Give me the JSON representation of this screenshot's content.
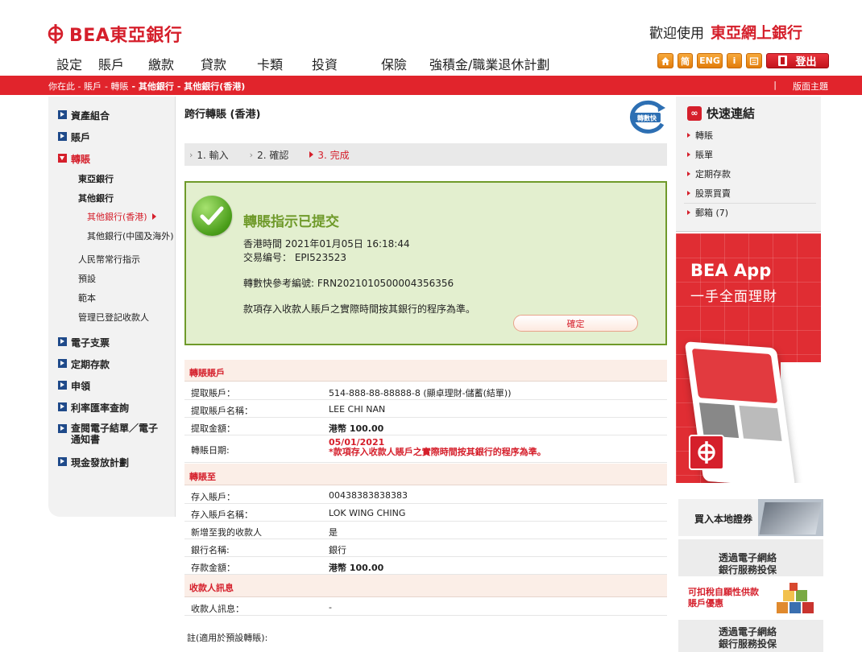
{
  "header": {
    "brand": "BEA東亞銀行",
    "welcome": "歡迎使用",
    "service": "東亞網上銀行"
  },
  "main_nav": [
    "設定",
    "賬戶",
    "繳款",
    "貸款",
    "卡類",
    "投資",
    "保險",
    "強積金/職業退休計劃"
  ],
  "utility": {
    "home_icon": "home-icon",
    "simplified": "简",
    "english": "ENG",
    "info": "i",
    "mail_icon": "inbox-icon",
    "logout": "登出"
  },
  "breadcrumb": {
    "prefix": "你在此 - 賬戶",
    "transfer": "- 轉賬",
    "other_bank": "- 其他銀行",
    "other_bank_hk": "- 其他銀行(香港)"
  },
  "theme": {
    "separator": "|",
    "label": "版面主題"
  },
  "sidebar": {
    "portfolio": "資產組合",
    "accounts": "賬戶",
    "transfer": "轉賬",
    "sub": {
      "bea": "東亞銀行",
      "other": "其他銀行",
      "other_hk": "其他銀行(香港)",
      "other_cn": "其他銀行(中國及海外)",
      "rmb": "人民幣常行指示",
      "preset": "預設",
      "template": "範本",
      "payees": "管理已登記收款人"
    },
    "echeque": "電子支票",
    "fixed_deposit": "定期存款",
    "apply": "申領",
    "rates": "利率匯率查詢",
    "estatement": "查閱電子結單／電子通知書",
    "cash_plan": "現金發放計劃"
  },
  "page": {
    "title": "跨行轉賬 (香港)",
    "fps_logo": "轉數快"
  },
  "steps": {
    "s1": "1. 輸入",
    "s2": "2. 確認",
    "s3": "3. 完成"
  },
  "success": {
    "title": "轉賬指示已提交",
    "time": "香港時間 2021年01月05日 16:18:44",
    "txn": "交易编号： EPI523523",
    "fps_ref": "轉數快參考編號: FRN2021010500004356356",
    "note": "款項存入收款人賬戶之實際時間按其銀行的程序為準。",
    "confirm": "確定"
  },
  "from_section": {
    "header": "轉賬賬戶",
    "rows": [
      {
        "label": "提取賬戶：",
        "value": "514-888-88-88888-8 (顯卓理財-儲蓄(結單))"
      },
      {
        "label": "提取賬戶名稱：",
        "value": "LEE CHI NAN"
      },
      {
        "label": "提取金額：",
        "value": "港幣 100.00"
      },
      {
        "label": "轉賬日期:",
        "value": "05/01/2021",
        "value2": "*款項存入收款人賬戶之實際時間按其銀行的程序為準。"
      }
    ]
  },
  "to_section": {
    "header": "轉賬至",
    "rows": [
      {
        "label": "存入賬戶：",
        "value": "00438383838383"
      },
      {
        "label": "存入賬戶名稱：",
        "value": "LOK WING CHING"
      },
      {
        "label": "新增至我的收款人",
        "value": "是"
      },
      {
        "label": "銀行名稱:",
        "value": "銀行"
      },
      {
        "label": "存款金額：",
        "value": "港幣 100.00"
      }
    ]
  },
  "payee_section": {
    "header": "收款人訊息",
    "rows": [
      {
        "label": "收款人訊息：",
        "value": "-"
      }
    ]
  },
  "footnote": "註(適用於預設轉賬):",
  "quick_links": {
    "title": "快速連結",
    "items": [
      "轉賬",
      "賬單",
      "定期存款",
      "股票買賣",
      "郵箱 (7)"
    ]
  },
  "app_banner": {
    "line1": "BEA App",
    "line2": "一手全面理財"
  },
  "ads": {
    "securities": "買入本地證券",
    "e_service_a": "透過電子網絡",
    "e_service_b": "銀行服務投保",
    "tax": "可扣稅自願性供款",
    "tax2": "賬戶優惠",
    "e_service2_a": "透過電子網絡",
    "e_service2_b": "銀行服務投保"
  },
  "colors": {
    "brand_red": "#d51f2b",
    "nav_blue": "#1f4a8a",
    "success_green": "#6f9a2a",
    "success_bg": "#e3efcf"
  }
}
